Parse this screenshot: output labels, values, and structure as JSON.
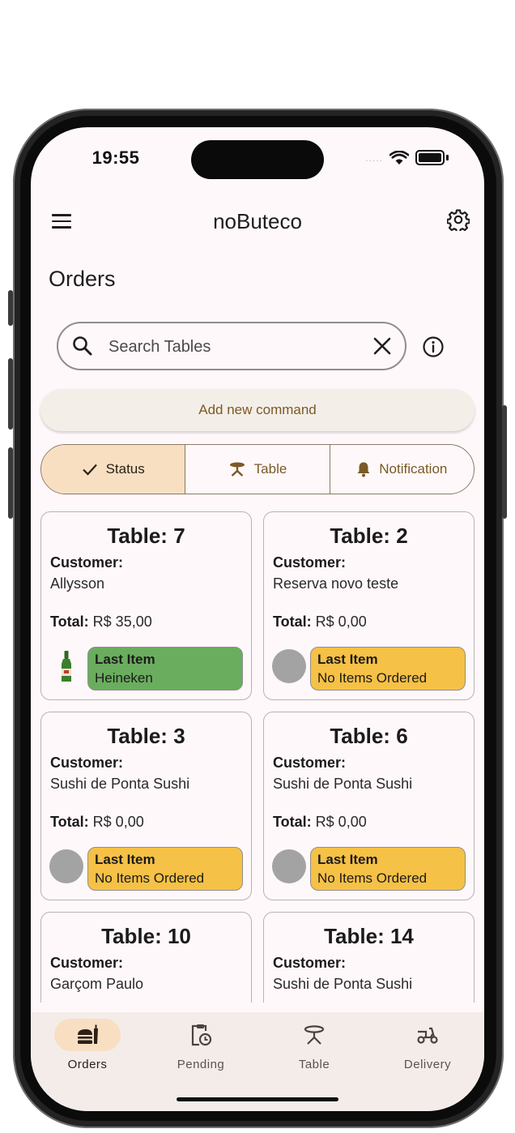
{
  "status_bar": {
    "time": "19:55",
    "signal": "....."
  },
  "app_bar": {
    "title": "noButeco",
    "menu_icon": "menu-icon",
    "settings_icon": "gear-icon"
  },
  "page": {
    "title": "Orders"
  },
  "search": {
    "placeholder": "Search Tables",
    "value": ""
  },
  "actions": {
    "add_command_label": "Add new command"
  },
  "filters": {
    "selected": "Status",
    "items": [
      {
        "label": "Status",
        "icon": "check-icon"
      },
      {
        "label": "Table",
        "icon": "table-icon"
      },
      {
        "label": "Notification",
        "icon": "bell-icon"
      }
    ]
  },
  "labels": {
    "customer": "Customer:",
    "total": "Total:",
    "last_item": "Last Item"
  },
  "tables": [
    {
      "title": "Table: 7",
      "customer": "Allysson",
      "total": "R$ 35,00",
      "last_item": "Heineken",
      "status": "green"
    },
    {
      "title": "Table: 2",
      "customer": "Reserva novo teste",
      "total": "R$ 0,00",
      "last_item": "No Items Ordered",
      "status": "yellow"
    },
    {
      "title": "Table: 3",
      "customer": "Sushi de Ponta Sushi",
      "total": "R$ 0,00",
      "last_item": "No Items Ordered",
      "status": "yellow"
    },
    {
      "title": "Table: 6",
      "customer": "Sushi de Ponta Sushi",
      "total": "R$ 0,00",
      "last_item": "No Items Ordered",
      "status": "yellow"
    },
    {
      "title": "Table: 10",
      "customer": "Garçom Paulo",
      "total": "",
      "last_item": "",
      "status": ""
    },
    {
      "title": "Table: 14",
      "customer": "Sushi de Ponta Sushi",
      "total": "",
      "last_item": "",
      "status": ""
    }
  ],
  "bottom_nav": {
    "selected": "Orders",
    "items": [
      {
        "label": "Orders",
        "icon": "orders-icon"
      },
      {
        "label": "Pending",
        "icon": "pending-icon"
      },
      {
        "label": "Table",
        "icon": "table-icon"
      },
      {
        "label": "Delivery",
        "icon": "delivery-icon"
      }
    ]
  },
  "colors": {
    "accent": "#f8dfc2",
    "brown_text": "#7a5a25",
    "green_badge": "#6aad5e",
    "yellow_badge": "#f5c146",
    "screen_bg": "#fff8fa"
  }
}
